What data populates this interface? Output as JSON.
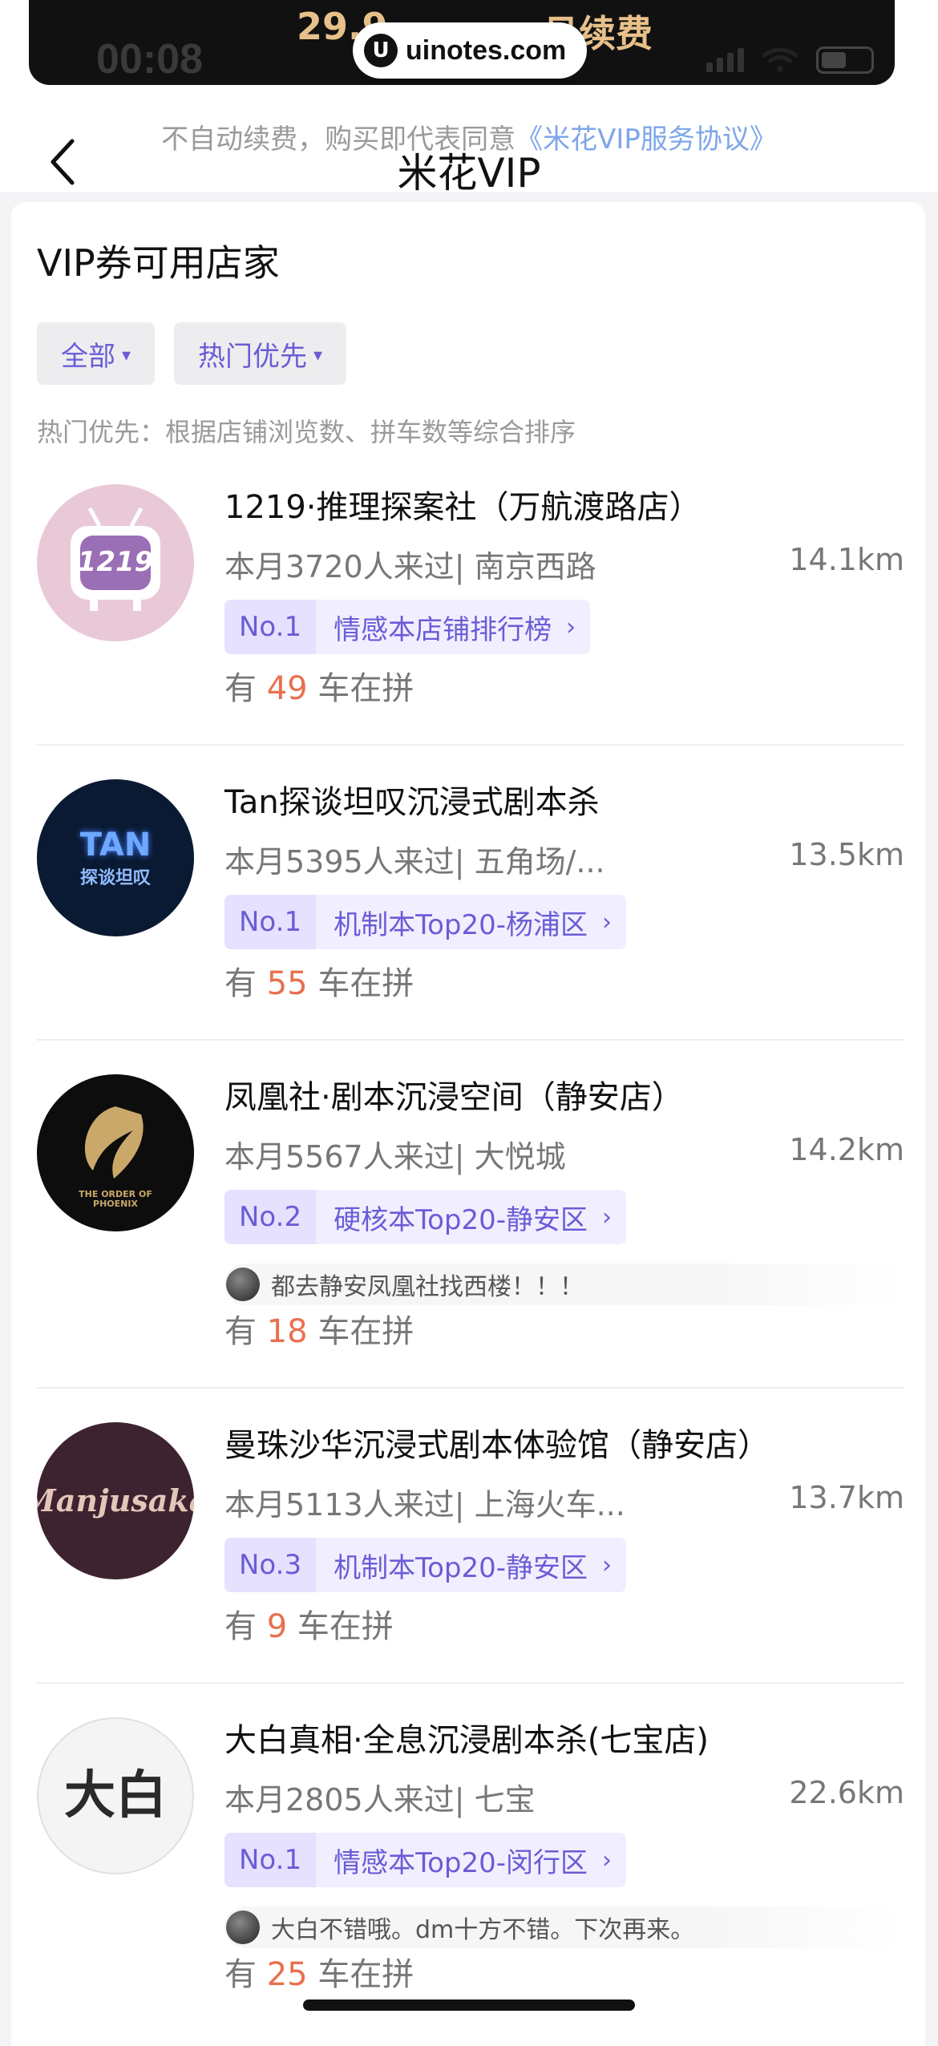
{
  "status_bar": {
    "time": "00:08",
    "banner_price": "29.9",
    "banner_renew": "月续费",
    "watermark": "uinotes.com"
  },
  "header": {
    "agreement_prefix": "不自动续费，购买即代表同意",
    "agreement_link": "《米花VIP服务协议》",
    "title": "米花VIP"
  },
  "sheet": {
    "title": "VIP券可用店家",
    "filters": [
      {
        "label": "全部"
      },
      {
        "label": "热门优先"
      }
    ],
    "sort_note": "热门优先：根据店铺浏览数、拼车数等综合排序",
    "carpool_prefix": "有",
    "carpool_suffix": "车在拼",
    "stores": [
      {
        "name": "1219·推理探案社（万航渡路店）",
        "visits": "本月3720人来过| 南京西路",
        "distance": "14.1km",
        "rank_no": "No.1",
        "rank_label": "情感本店铺排行榜",
        "carpool_count": "49",
        "logo_text": "1219"
      },
      {
        "name": "Tan探谈坦叹沉浸式剧本杀",
        "visits": "本月5395人来过| 五角场/...",
        "distance": "13.5km",
        "rank_no": "No.1",
        "rank_label": "机制本Top20-杨浦区",
        "carpool_count": "55",
        "logo_text": "TAN",
        "logo_sub": "探谈坦叹"
      },
      {
        "name": "凤凰社·剧本沉浸空间（静安店）",
        "visits": "本月5567人来过| 大悦城",
        "distance": "14.2km",
        "rank_no": "No.2",
        "rank_label": "硬核本Top20-静安区",
        "comment": "都去静安凤凰社找西楼！！！",
        "carpool_count": "18",
        "logo_text": "THE ORDER OF PHOENIX"
      },
      {
        "name": "曼珠沙华沉浸式剧本体验馆（静安店）",
        "visits": "本月5113人来过| 上海火车...",
        "distance": "13.7km",
        "rank_no": "No.3",
        "rank_label": "机制本Top20-静安区",
        "carpool_count": "9",
        "logo_text": "Manjusaka"
      },
      {
        "name": "大白真相·全息沉浸剧本杀(七宝店)",
        "visits": "本月2805人来过| 七宝",
        "distance": "22.6km",
        "rank_no": "No.1",
        "rank_label": "情感本Top20-闵行区",
        "comment": "大白不错哦。dm十方不错。下次再来。",
        "carpool_count": "25",
        "logo_text": "大白"
      }
    ]
  }
}
